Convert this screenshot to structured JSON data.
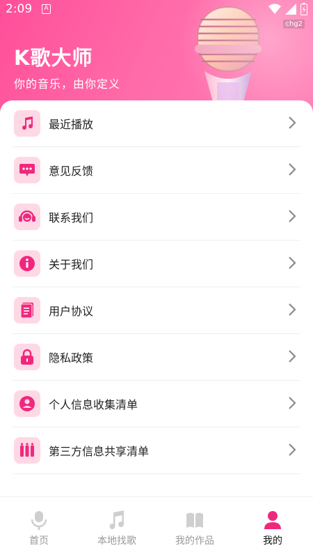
{
  "status": {
    "time": "2:09",
    "a_badge": "A",
    "carrier_tag": "chg2"
  },
  "header": {
    "title": "K歌大师",
    "subtitle": "你的音乐，由你定义"
  },
  "menu": [
    {
      "label": "最近播放",
      "icon": "music-note-icon"
    },
    {
      "label": "意见反馈",
      "icon": "chat-bubble-icon"
    },
    {
      "label": "联系我们",
      "icon": "headset-icon"
    },
    {
      "label": "关于我们",
      "icon": "info-icon"
    },
    {
      "label": "用户协议",
      "icon": "document-icon"
    },
    {
      "label": "隐私政策",
      "icon": "lock-icon"
    },
    {
      "label": "个人信息收集清单",
      "icon": "user-circle-icon"
    },
    {
      "label": "第三方信息共享清单",
      "icon": "three-bars-icon"
    }
  ],
  "tabs": [
    {
      "label": "首页",
      "icon": "microphone-icon"
    },
    {
      "label": "本地找歌",
      "icon": "music-note-icon"
    },
    {
      "label": "我的作品",
      "icon": "book-icon"
    },
    {
      "label": "我的",
      "icon": "person-icon",
      "active": true
    }
  ],
  "colors": {
    "accent": "#f0287d",
    "header_start": "#ff4f9a",
    "icon_bg": "#ffd8e6",
    "inactive": "#c8c8c8"
  }
}
